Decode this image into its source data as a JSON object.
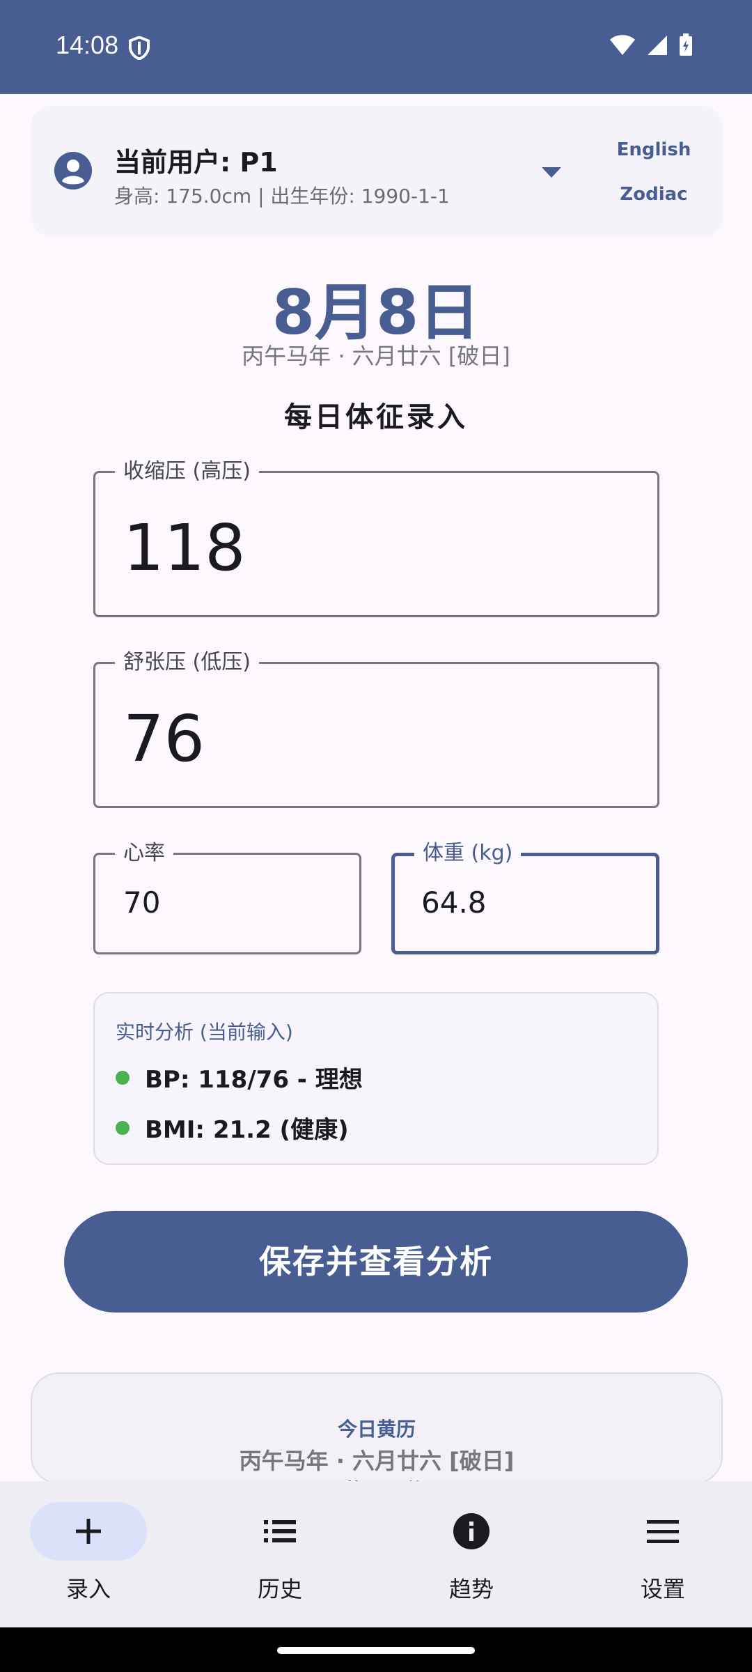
{
  "status_bar": {
    "time": "14:08"
  },
  "user": {
    "title": "当前用户: P1",
    "subtitle": "身高: 175.0cm | 出生年份: 1990-1-1",
    "lang_english": "English",
    "lang_zodiac": "Zodiac"
  },
  "date": {
    "big": "8月8日",
    "lunar": "丙午马年 · 六月廿六 [破日]"
  },
  "form": {
    "title": "每日体征录入",
    "systolic": {
      "label": "收缩压 (高压)",
      "value": "118"
    },
    "diastolic": {
      "label": "舒张压 (低压)",
      "value": "76"
    },
    "heart_rate": {
      "label": "心率",
      "value": "70"
    },
    "weight": {
      "label": "体重 (kg)",
      "value": "64.8"
    }
  },
  "analysis": {
    "title": "实时分析 (当前输入)",
    "bp": "BP: 118/76 - 理想",
    "bmi": "BMI: 21.2 (健康)",
    "status_color": "#4caf50"
  },
  "save_button": "保存并查看分析",
  "almanac": {
    "title": "今日黄历",
    "lunar": "丙午马年 · 六月廿六 [破日]",
    "line3": "五黄 [黑道]"
  },
  "nav": {
    "items": [
      {
        "label": "录入",
        "icon": "add-icon",
        "active": true
      },
      {
        "label": "历史",
        "icon": "list-icon",
        "active": false
      },
      {
        "label": "趋势",
        "icon": "info-icon",
        "active": false
      },
      {
        "label": "设置",
        "icon": "menu-icon",
        "active": false
      }
    ]
  },
  "colors": {
    "primary": "#485d92",
    "background": "#fcf8fd",
    "nav_active": "#dbe1fb"
  }
}
